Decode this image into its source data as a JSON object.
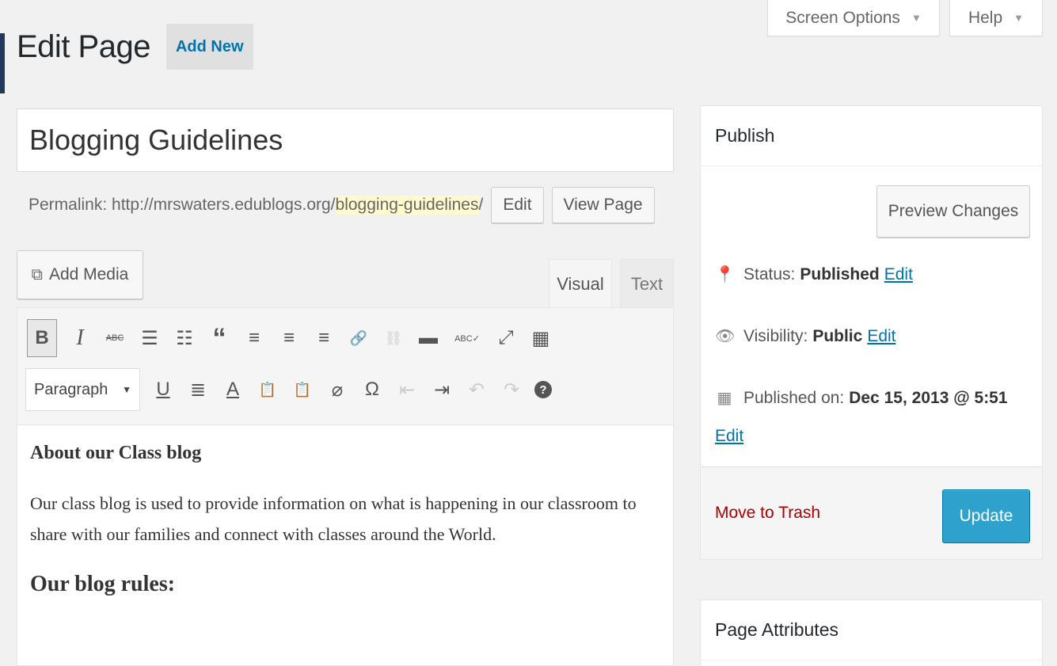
{
  "header": {
    "title": "Edit Page",
    "add_new_label": "Add New",
    "screen_options_label": "Screen Options",
    "help_label": "Help"
  },
  "post": {
    "title": "Blogging Guidelines",
    "permalink_label": "Permalink:",
    "permalink_base": "http://mrswaters.edublogs.org/",
    "permalink_slug": "blogging-guidelines",
    "permalink_trail": "/",
    "edit_button": "Edit",
    "view_button": "View Page"
  },
  "editor": {
    "add_media_label": "Add Media",
    "tab_visual": "Visual",
    "tab_text": "Text",
    "format_select_value": "Paragraph",
    "content": {
      "heading": "About our Class blog",
      "paragraph": "Our class blog is used to provide information on what is happening in our classroom to share with our families and connect with classes around the World.",
      "subheading": "Our blog rules:"
    }
  },
  "publish_box": {
    "title": "Publish",
    "preview_label": "Preview Changes",
    "status_label": "Status:",
    "status_value": "Published",
    "visibility_label": "Visibility:",
    "visibility_value": "Public",
    "published_label": "Published on:",
    "published_value": "Dec 15, 2013 @ 5:51",
    "edit_link": "Edit",
    "trash_label": "Move to Trash",
    "update_label": "Update"
  },
  "attributes_box": {
    "title": "Page Attributes"
  },
  "icons": {
    "bold": "B",
    "italic": "I",
    "strikethrough": "ABC",
    "bullet_list": "☰",
    "numbered_list": "☷",
    "blockquote": "“",
    "align_left": "≡",
    "align_center": "≡",
    "align_right": "≡",
    "link": "🔗",
    "unlink": "⛓",
    "more": "▬",
    "spellcheck": "ABC✓",
    "fullscreen": "⤢",
    "kitchen_sink": "▦",
    "underline": "U",
    "justify": "≣",
    "text_color": "A",
    "paste_text": "📋",
    "paste_word": "📋",
    "clear_format": "⌀",
    "special_char": "Ω",
    "outdent": "⇤",
    "indent": "⇥",
    "undo": "↶",
    "redo": "↷",
    "help": "?"
  },
  "colors": {
    "accent": "#0073aa",
    "update_button": "#2ea2cc",
    "trash": "#aa0000",
    "slug_highlight": "#fffbcc"
  }
}
